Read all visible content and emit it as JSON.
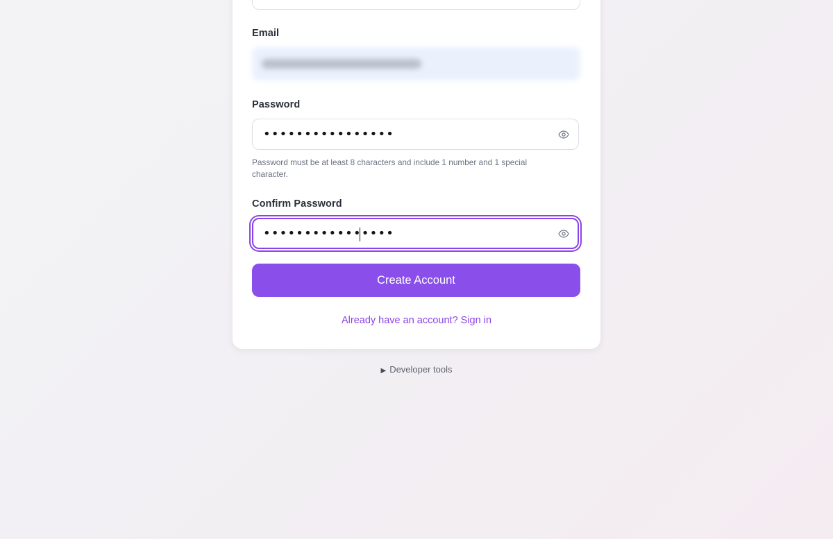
{
  "form": {
    "email_label": "Email",
    "password_label": "Password",
    "password_value": "••••••••••••••••",
    "password_hint": "Password must be at least 8 characters and include 1 number and 1 special character.",
    "confirm_password_label": "Confirm Password",
    "confirm_password_value": "••••••••••••••••",
    "create_account_label": "Create Account",
    "signin_link_label": "Already have an account? Sign in"
  },
  "footer": {
    "devtools_label": "Developer tools",
    "devtools_arrow": "▶"
  },
  "icons": {
    "password_toggle": "eye-icon",
    "confirm_password_toggle": "eye-icon",
    "devtools_toggle": "triangle-right-icon"
  },
  "colors": {
    "accent": "#8a4eea",
    "focus_ring": "#8a43e6",
    "link": "#8a43e6"
  }
}
